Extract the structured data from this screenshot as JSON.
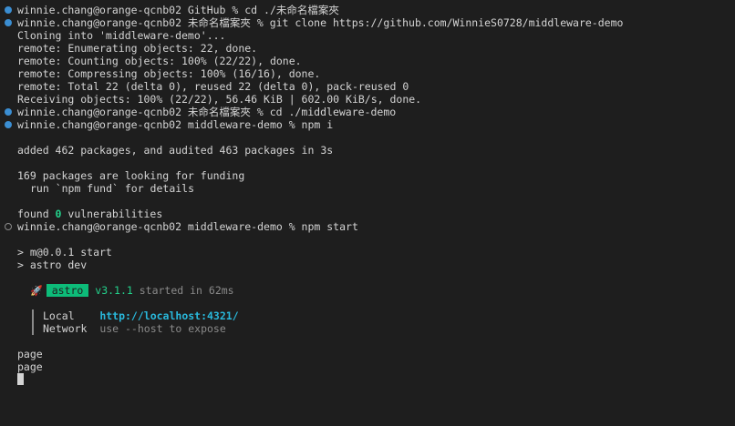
{
  "terminal": {
    "lines": [
      {
        "type": "prompt",
        "marker": "done",
        "text": "winnie.chang@orange-qcnb02 GitHub % cd ./未命名檔案夾"
      },
      {
        "type": "prompt",
        "marker": "done",
        "text": "winnie.chang@orange-qcnb02 未命名檔案夾 % git clone https://github.com/WinnieS0728/middleware-demo"
      },
      {
        "type": "text",
        "text": "Cloning into 'middleware-demo'..."
      },
      {
        "type": "text",
        "text": "remote: Enumerating objects: 22, done."
      },
      {
        "type": "text",
        "text": "remote: Counting objects: 100% (22/22), done."
      },
      {
        "type": "text",
        "text": "remote: Compressing objects: 100% (16/16), done."
      },
      {
        "type": "text",
        "text": "remote: Total 22 (delta 0), reused 22 (delta 0), pack-reused 0"
      },
      {
        "type": "text",
        "text": "Receiving objects: 100% (22/22), 56.46 KiB | 602.00 KiB/s, done."
      },
      {
        "type": "prompt",
        "marker": "done",
        "text": "winnie.chang@orange-qcnb02 未命名檔案夾 % cd ./middleware-demo"
      },
      {
        "type": "prompt",
        "marker": "done",
        "text": "winnie.chang@orange-qcnb02 middleware-demo % npm i"
      },
      {
        "type": "blank"
      },
      {
        "type": "text",
        "text": "added 462 packages, and audited 463 packages in 3s"
      },
      {
        "type": "blank"
      },
      {
        "type": "text",
        "text": "169 packages are looking for funding"
      },
      {
        "type": "text",
        "indent": true,
        "text": "run `npm fund` for details"
      },
      {
        "type": "blank"
      },
      {
        "type": "vuln",
        "prefix": "found ",
        "count": "0",
        "suffix": " vulnerabilities"
      },
      {
        "type": "prompt",
        "marker": "running",
        "text": "winnie.chang@orange-qcnb02 middleware-demo % npm start"
      },
      {
        "type": "blank"
      },
      {
        "type": "text",
        "text": "> m@0.0.1 start"
      },
      {
        "type": "text",
        "text": "> astro dev"
      },
      {
        "type": "blank"
      },
      {
        "type": "astro",
        "rocket": "🚀",
        "badge": "astro",
        "version": "v3.1.1",
        "started": " started in 62ms"
      },
      {
        "type": "blank"
      },
      {
        "type": "net",
        "label": "Local    ",
        "value": "http://localhost:4321/",
        "style": "url"
      },
      {
        "type": "net",
        "label": "Network  ",
        "value": "use --host to expose",
        "style": "muted"
      },
      {
        "type": "blank"
      },
      {
        "type": "text",
        "text": "page"
      },
      {
        "type": "text",
        "text": "page"
      },
      {
        "type": "cursor"
      }
    ]
  }
}
